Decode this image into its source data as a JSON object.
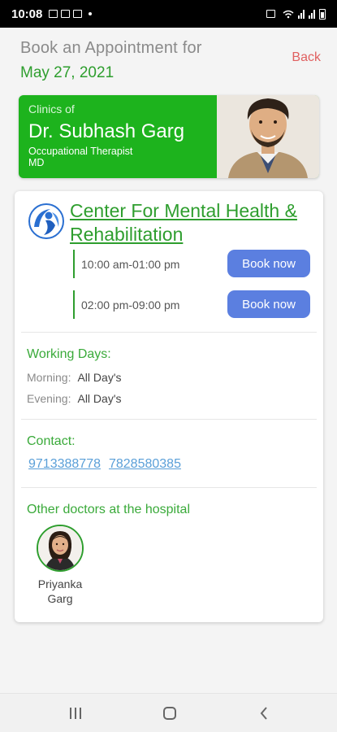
{
  "status_bar": {
    "time": "10:08",
    "signal_label": "ıll"
  },
  "header": {
    "title": "Book an Appointment for",
    "date": "May 27, 2021",
    "back_label": "Back"
  },
  "doctor": {
    "clinics_of_label": "Clinics of",
    "name": "Dr. Subhash Garg",
    "specialty": "Occupational Therapist",
    "degree": "MD"
  },
  "clinic": {
    "name": "Center For Mental Health & Rehabilitation",
    "slots": [
      {
        "time": "10:00 am-01:00 pm",
        "button": "Book now"
      },
      {
        "time": "02:00 pm-09:00 pm",
        "button": "Book now"
      }
    ],
    "working_days": {
      "title": "Working Days:",
      "morning_label": "Morning:",
      "morning_value": "All Day's",
      "evening_label": "Evening:",
      "evening_value": "All Day's"
    },
    "contact": {
      "title": "Contact:",
      "phones": [
        "9713388778",
        "7828580385"
      ]
    },
    "other_doctors": {
      "title": "Other doctors at the hospital",
      "doctors": [
        {
          "name_line1": "Priyanka",
          "name_line2": "Garg"
        }
      ]
    }
  },
  "colors": {
    "brand_green": "#1db31d",
    "text_green": "#2e9e2e",
    "button_blue": "#5b7fe0",
    "back_red": "#e06060",
    "link_blue": "#5a9fd8"
  }
}
